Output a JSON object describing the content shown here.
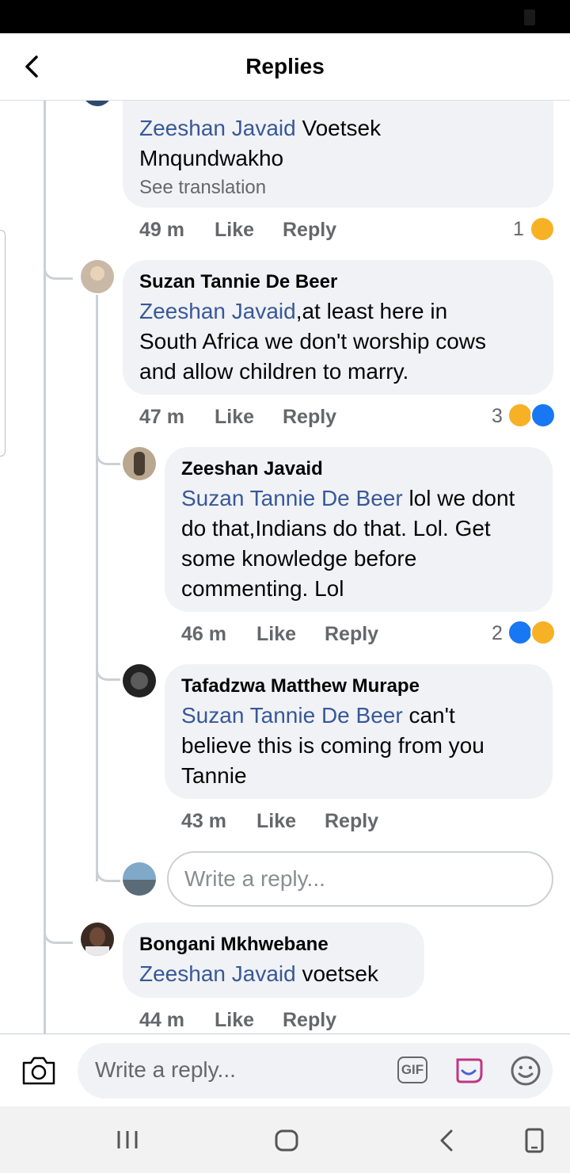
{
  "header": {
    "title": "Replies"
  },
  "top_comment": {
    "mention": "Zeeshan Javaid",
    "text_after_mention_line1": " Voetsek",
    "text_line2": "Mnqundwakho",
    "see_translation": "See translation",
    "time": "49 m",
    "like_label": "Like",
    "reply_label": "Reply",
    "reaction_count": "1"
  },
  "comments": [
    {
      "author": "Suzan Tannie De Beer",
      "mention": "Zeeshan Javaid",
      "line1_rest": ",at least here in",
      "line2": "South Africa we don't worship cows",
      "line3": "and allow children to marry.",
      "time": "47 m",
      "like_label": "Like",
      "reply_label": "Reply",
      "reaction_count": "3"
    },
    {
      "author": "Zeeshan Javaid",
      "mention": "Suzan Tannie De Beer",
      "line1_rest": " lol we dont",
      "line2": "do that,Indians do that. Lol. Get",
      "line3": "some knowledge before",
      "line4": "commenting. Lol",
      "time": "46 m",
      "like_label": "Like",
      "reply_label": "Reply",
      "reaction_count": "2"
    },
    {
      "author": "Tafadzwa Matthew Murape",
      "mention": "Suzan Tannie De Beer",
      "line1_rest": " can't",
      "line2": "believe this is coming from you",
      "line3": "Tannie",
      "time": "43 m",
      "like_label": "Like",
      "reply_label": "Reply"
    },
    {
      "author": "Bongani Mkhwebane",
      "mention": "Zeeshan Javaid",
      "line1_rest": " voetsek",
      "time": "44 m",
      "like_label": "Like",
      "reply_label": "Reply"
    }
  ],
  "nested_reply_box": {
    "placeholder": "Write a reply..."
  },
  "composer": {
    "placeholder": "Write a reply...",
    "gif_label": "GIF"
  },
  "icons": {
    "back": "chevron-left-icon",
    "camera": "camera-icon",
    "gif": "gif-icon",
    "sticker": "sticker-icon",
    "emoji": "emoji-icon",
    "haha_reaction": "haha-reaction-icon",
    "like_reaction": "like-reaction-icon",
    "nav_recent": "recent-apps-icon",
    "nav_home": "home-icon",
    "nav_back": "back-icon",
    "nav_rotate": "rotate-icon"
  },
  "colors": {
    "mention": "#385898",
    "bubble_bg": "#f0f2f5",
    "meta_text": "#65676b",
    "like_blue": "#1877f2",
    "haha_yellow": "#f7b125"
  }
}
